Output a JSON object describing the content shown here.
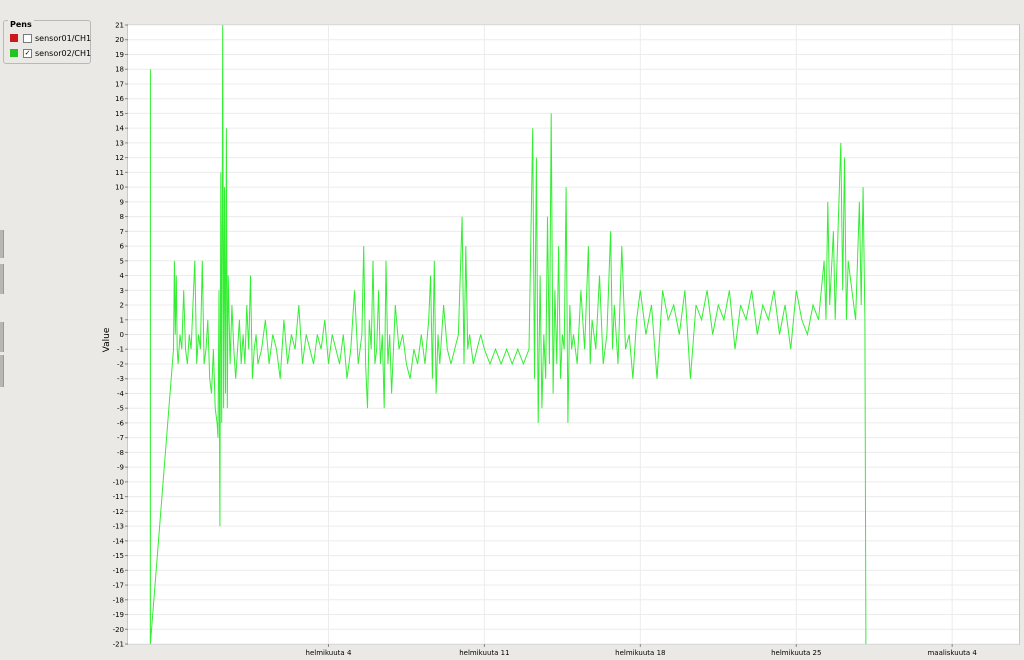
{
  "legend": {
    "title": "Pens",
    "items": [
      {
        "label": "sensor01/CH1",
        "color": "#cc1a1a",
        "checked": false
      },
      {
        "label": "sensor02/CH1",
        "color": "#22c422",
        "checked": true
      }
    ]
  },
  "chart_data": {
    "type": "line",
    "ylabel": "Value",
    "ylim": [
      -21,
      21
    ],
    "yticks": [
      21,
      20,
      19,
      18,
      17,
      16,
      15,
      14,
      13,
      12,
      11,
      10,
      9,
      8,
      7,
      6,
      5,
      4,
      3,
      2,
      1,
      0,
      -1,
      -2,
      -3,
      -4,
      -5,
      -6,
      -7,
      -8,
      -9,
      -10,
      -11,
      -12,
      -13,
      -14,
      -15,
      -16,
      -17,
      -18,
      -19,
      -20,
      -21
    ],
    "xlim": [
      "2025-01-26",
      "2025-03-07"
    ],
    "xticks": [
      {
        "date": "2025-02-04",
        "label": "helmikuuta 4"
      },
      {
        "date": "2025-02-11",
        "label": "helmikuuta 11"
      },
      {
        "date": "2025-02-18",
        "label": "helmikuuta 18"
      },
      {
        "date": "2025-02-25",
        "label": "helmikuuta 25"
      },
      {
        "date": "2025-03-04",
        "label": "maaliskuuta 4"
      }
    ],
    "grid": true,
    "series": [
      {
        "name": "sensor02/CH1",
        "color": "#33ee33",
        "points": [
          [
            "2025-01-27 00:00",
            -21
          ],
          [
            "2025-01-27 00:05",
            18
          ],
          [
            "2025-01-27 00:10",
            -21
          ],
          [
            "2025-01-28 01:00",
            -1
          ],
          [
            "2025-01-28 02:00",
            5
          ],
          [
            "2025-01-28 03:00",
            0
          ],
          [
            "2025-01-28 04:00",
            4
          ],
          [
            "2025-01-28 05:00",
            -1
          ],
          [
            "2025-01-28 06:00",
            -2
          ],
          [
            "2025-01-28 08:00",
            0
          ],
          [
            "2025-01-28 10:00",
            -1
          ],
          [
            "2025-01-28 12:00",
            3
          ],
          [
            "2025-01-28 14:00",
            -1
          ],
          [
            "2025-01-28 16:00",
            -2
          ],
          [
            "2025-01-28 18:00",
            0
          ],
          [
            "2025-01-28 20:00",
            -1
          ],
          [
            "2025-01-29 00:00",
            5
          ],
          [
            "2025-01-29 02:00",
            -2
          ],
          [
            "2025-01-29 04:00",
            0
          ],
          [
            "2025-01-29 06:00",
            -1
          ],
          [
            "2025-01-29 08:00",
            5
          ],
          [
            "2025-01-29 10:00",
            -2
          ],
          [
            "2025-01-29 12:00",
            -1
          ],
          [
            "2025-01-29 14:00",
            1
          ],
          [
            "2025-01-29 16:00",
            -3
          ],
          [
            "2025-01-29 18:00",
            -4
          ],
          [
            "2025-01-29 20:00",
            -1
          ],
          [
            "2025-01-29 22:00",
            -5
          ],
          [
            "2025-01-30 00:00",
            -6
          ],
          [
            "2025-01-30 01:00",
            -7
          ],
          [
            "2025-01-30 02:00",
            3
          ],
          [
            "2025-01-30 03:00",
            -13
          ],
          [
            "2025-01-30 04:00",
            11
          ],
          [
            "2025-01-30 05:00",
            -6
          ],
          [
            "2025-01-30 06:00",
            21
          ],
          [
            "2025-01-30 07:00",
            -5
          ],
          [
            "2025-01-30 08:00",
            10
          ],
          [
            "2025-01-30 09:00",
            -4
          ],
          [
            "2025-01-30 10:00",
            14
          ],
          [
            "2025-01-30 11:00",
            -5
          ],
          [
            "2025-01-30 12:00",
            4
          ],
          [
            "2025-01-30 14:00",
            -2
          ],
          [
            "2025-01-30 16:00",
            2
          ],
          [
            "2025-01-30 18:00",
            -1
          ],
          [
            "2025-01-30 20:00",
            -3
          ],
          [
            "2025-01-31 00:00",
            1
          ],
          [
            "2025-01-31 02:00",
            -2
          ],
          [
            "2025-01-31 04:00",
            0
          ],
          [
            "2025-01-31 06:00",
            -2
          ],
          [
            "2025-01-31 08:00",
            2
          ],
          [
            "2025-01-31 10:00",
            -1
          ],
          [
            "2025-01-31 12:00",
            4
          ],
          [
            "2025-01-31 14:00",
            -3
          ],
          [
            "2025-01-31 16:00",
            -1
          ],
          [
            "2025-01-31 18:00",
            0
          ],
          [
            "2025-01-31 20:00",
            -2
          ],
          [
            "2025-02-01 00:00",
            -1
          ],
          [
            "2025-02-01 04:00",
            1
          ],
          [
            "2025-02-01 08:00",
            -2
          ],
          [
            "2025-02-01 12:00",
            0
          ],
          [
            "2025-02-01 16:00",
            -1
          ],
          [
            "2025-02-01 20:00",
            -3
          ],
          [
            "2025-02-02 00:00",
            1
          ],
          [
            "2025-02-02 04:00",
            -2
          ],
          [
            "2025-02-02 08:00",
            0
          ],
          [
            "2025-02-02 12:00",
            -1
          ],
          [
            "2025-02-02 16:00",
            2
          ],
          [
            "2025-02-02 20:00",
            -2
          ],
          [
            "2025-02-03 00:00",
            0
          ],
          [
            "2025-02-03 04:00",
            -1
          ],
          [
            "2025-02-03 08:00",
            -2
          ],
          [
            "2025-02-03 12:00",
            0
          ],
          [
            "2025-02-03 16:00",
            -1
          ],
          [
            "2025-02-03 20:00",
            1
          ],
          [
            "2025-02-04 00:00",
            -2
          ],
          [
            "2025-02-04 04:00",
            0
          ],
          [
            "2025-02-04 08:00",
            -1
          ],
          [
            "2025-02-04 12:00",
            -2
          ],
          [
            "2025-02-04 16:00",
            0
          ],
          [
            "2025-02-04 20:00",
            -3
          ],
          [
            "2025-02-05 00:00",
            -1
          ],
          [
            "2025-02-05 04:00",
            3
          ],
          [
            "2025-02-05 08:00",
            -2
          ],
          [
            "2025-02-05 12:00",
            0
          ],
          [
            "2025-02-05 14:00",
            6
          ],
          [
            "2025-02-05 16:00",
            -2
          ],
          [
            "2025-02-05 18:00",
            -5
          ],
          [
            "2025-02-05 20:00",
            1
          ],
          [
            "2025-02-05 22:00",
            -1
          ],
          [
            "2025-02-06 00:00",
            5
          ],
          [
            "2025-02-06 02:00",
            -2
          ],
          [
            "2025-02-06 04:00",
            -1
          ],
          [
            "2025-02-06 06:00",
            3
          ],
          [
            "2025-02-06 08:00",
            -2
          ],
          [
            "2025-02-06 10:00",
            0
          ],
          [
            "2025-02-06 12:00",
            -5
          ],
          [
            "2025-02-06 14:00",
            5
          ],
          [
            "2025-02-06 16:00",
            -2
          ],
          [
            "2025-02-06 18:00",
            0
          ],
          [
            "2025-02-06 20:00",
            -4
          ],
          [
            "2025-02-07 00:00",
            2
          ],
          [
            "2025-02-07 04:00",
            -1
          ],
          [
            "2025-02-07 08:00",
            0
          ],
          [
            "2025-02-07 12:00",
            -2
          ],
          [
            "2025-02-07 16:00",
            -3
          ],
          [
            "2025-02-07 20:00",
            -1
          ],
          [
            "2025-02-08 00:00",
            -2
          ],
          [
            "2025-02-08 04:00",
            0
          ],
          [
            "2025-02-08 08:00",
            -2
          ],
          [
            "2025-02-08 12:00",
            1
          ],
          [
            "2025-02-08 14:00",
            4
          ],
          [
            "2025-02-08 16:00",
            -3
          ],
          [
            "2025-02-08 18:00",
            5
          ],
          [
            "2025-02-08 20:00",
            -4
          ],
          [
            "2025-02-08 22:00",
            0
          ],
          [
            "2025-02-09 00:00",
            -2
          ],
          [
            "2025-02-09 04:00",
            2
          ],
          [
            "2025-02-09 08:00",
            -1
          ],
          [
            "2025-02-09 12:00",
            -2
          ],
          [
            "2025-02-09 16:00",
            -1
          ],
          [
            "2025-02-09 20:00",
            0
          ],
          [
            "2025-02-10 00:00",
            8
          ],
          [
            "2025-02-10 02:00",
            -2
          ],
          [
            "2025-02-10 04:00",
            6
          ],
          [
            "2025-02-10 06:00",
            -1
          ],
          [
            "2025-02-10 08:00",
            0
          ],
          [
            "2025-02-10 12:00",
            -2
          ],
          [
            "2025-02-10 16:00",
            -1
          ],
          [
            "2025-02-10 20:00",
            0
          ],
          [
            "2025-02-11 00:00",
            -1
          ],
          [
            "2025-02-11 06:00",
            -2
          ],
          [
            "2025-02-11 12:00",
            -1
          ],
          [
            "2025-02-11 18:00",
            -2
          ],
          [
            "2025-02-12 00:00",
            -1
          ],
          [
            "2025-02-12 06:00",
            -2
          ],
          [
            "2025-02-12 12:00",
            -1
          ],
          [
            "2025-02-12 18:00",
            -2
          ],
          [
            "2025-02-13 00:00",
            -1
          ],
          [
            "2025-02-13 04:00",
            14
          ],
          [
            "2025-02-13 06:00",
            -3
          ],
          [
            "2025-02-13 08:00",
            12
          ],
          [
            "2025-02-13 10:00",
            -6
          ],
          [
            "2025-02-13 12:00",
            4
          ],
          [
            "2025-02-13 14:00",
            -5
          ],
          [
            "2025-02-13 16:00",
            0
          ],
          [
            "2025-02-13 18:00",
            -3
          ],
          [
            "2025-02-13 20:00",
            8
          ],
          [
            "2025-02-13 22:00",
            -2
          ],
          [
            "2025-02-14 00:00",
            15
          ],
          [
            "2025-02-14 02:00",
            -4
          ],
          [
            "2025-02-14 04:00",
            3
          ],
          [
            "2025-02-14 06:00",
            -2
          ],
          [
            "2025-02-14 08:00",
            6
          ],
          [
            "2025-02-14 10:00",
            -3
          ],
          [
            "2025-02-14 12:00",
            0
          ],
          [
            "2025-02-14 14:00",
            -1
          ],
          [
            "2025-02-14 16:00",
            10
          ],
          [
            "2025-02-14 18:00",
            -6
          ],
          [
            "2025-02-14 20:00",
            2
          ],
          [
            "2025-02-14 22:00",
            -1
          ],
          [
            "2025-02-15 00:00",
            0
          ],
          [
            "2025-02-15 04:00",
            -2
          ],
          [
            "2025-02-15 08:00",
            3
          ],
          [
            "2025-02-15 12:00",
            -1
          ],
          [
            "2025-02-15 16:00",
            6
          ],
          [
            "2025-02-15 18:00",
            -2
          ],
          [
            "2025-02-15 20:00",
            1
          ],
          [
            "2025-02-16 00:00",
            -1
          ],
          [
            "2025-02-16 04:00",
            4
          ],
          [
            "2025-02-16 08:00",
            -2
          ],
          [
            "2025-02-16 12:00",
            0
          ],
          [
            "2025-02-16 16:00",
            7
          ],
          [
            "2025-02-16 18:00",
            -1
          ],
          [
            "2025-02-16 20:00",
            2
          ],
          [
            "2025-02-17 00:00",
            -2
          ],
          [
            "2025-02-17 04:00",
            6
          ],
          [
            "2025-02-17 08:00",
            -1
          ],
          [
            "2025-02-17 12:00",
            0
          ],
          [
            "2025-02-17 16:00",
            -3
          ],
          [
            "2025-02-17 20:00",
            1
          ],
          [
            "2025-02-18 00:00",
            3
          ],
          [
            "2025-02-18 06:00",
            0
          ],
          [
            "2025-02-18 12:00",
            2
          ],
          [
            "2025-02-18 18:00",
            -3
          ],
          [
            "2025-02-19 00:00",
            3
          ],
          [
            "2025-02-19 06:00",
            1
          ],
          [
            "2025-02-19 12:00",
            2
          ],
          [
            "2025-02-19 18:00",
            0
          ],
          [
            "2025-02-20 00:00",
            3
          ],
          [
            "2025-02-20 06:00",
            -3
          ],
          [
            "2025-02-20 12:00",
            2
          ],
          [
            "2025-02-20 18:00",
            1
          ],
          [
            "2025-02-21 00:00",
            3
          ],
          [
            "2025-02-21 06:00",
            0
          ],
          [
            "2025-02-21 12:00",
            2
          ],
          [
            "2025-02-21 18:00",
            1
          ],
          [
            "2025-02-22 00:00",
            3
          ],
          [
            "2025-02-22 06:00",
            -1
          ],
          [
            "2025-02-22 12:00",
            2
          ],
          [
            "2025-02-22 18:00",
            1
          ],
          [
            "2025-02-23 00:00",
            3
          ],
          [
            "2025-02-23 06:00",
            0
          ],
          [
            "2025-02-23 12:00",
            2
          ],
          [
            "2025-02-23 18:00",
            1
          ],
          [
            "2025-02-24 00:00",
            3
          ],
          [
            "2025-02-24 06:00",
            0
          ],
          [
            "2025-02-24 12:00",
            2
          ],
          [
            "2025-02-24 18:00",
            -1
          ],
          [
            "2025-02-25 00:00",
            3
          ],
          [
            "2025-02-25 06:00",
            1
          ],
          [
            "2025-02-25 12:00",
            0
          ],
          [
            "2025-02-25 18:00",
            2
          ],
          [
            "2025-02-26 00:00",
            1
          ],
          [
            "2025-02-26 06:00",
            5
          ],
          [
            "2025-02-26 08:00",
            1
          ],
          [
            "2025-02-26 10:00",
            9
          ],
          [
            "2025-02-26 12:00",
            2
          ],
          [
            "2025-02-26 16:00",
            7
          ],
          [
            "2025-02-26 18:00",
            1
          ],
          [
            "2025-02-27 00:00",
            13
          ],
          [
            "2025-02-27 02:00",
            3
          ],
          [
            "2025-02-27 04:00",
            12
          ],
          [
            "2025-02-27 06:00",
            1
          ],
          [
            "2025-02-27 08:00",
            5
          ],
          [
            "2025-02-27 12:00",
            3
          ],
          [
            "2025-02-27 16:00",
            1
          ],
          [
            "2025-02-27 20:00",
            9
          ],
          [
            "2025-02-27 22:00",
            2
          ],
          [
            "2025-02-28 00:00",
            10
          ],
          [
            "2025-02-28 02:00",
            1
          ],
          [
            "2025-02-28 03:00",
            -21
          ]
        ]
      }
    ]
  }
}
